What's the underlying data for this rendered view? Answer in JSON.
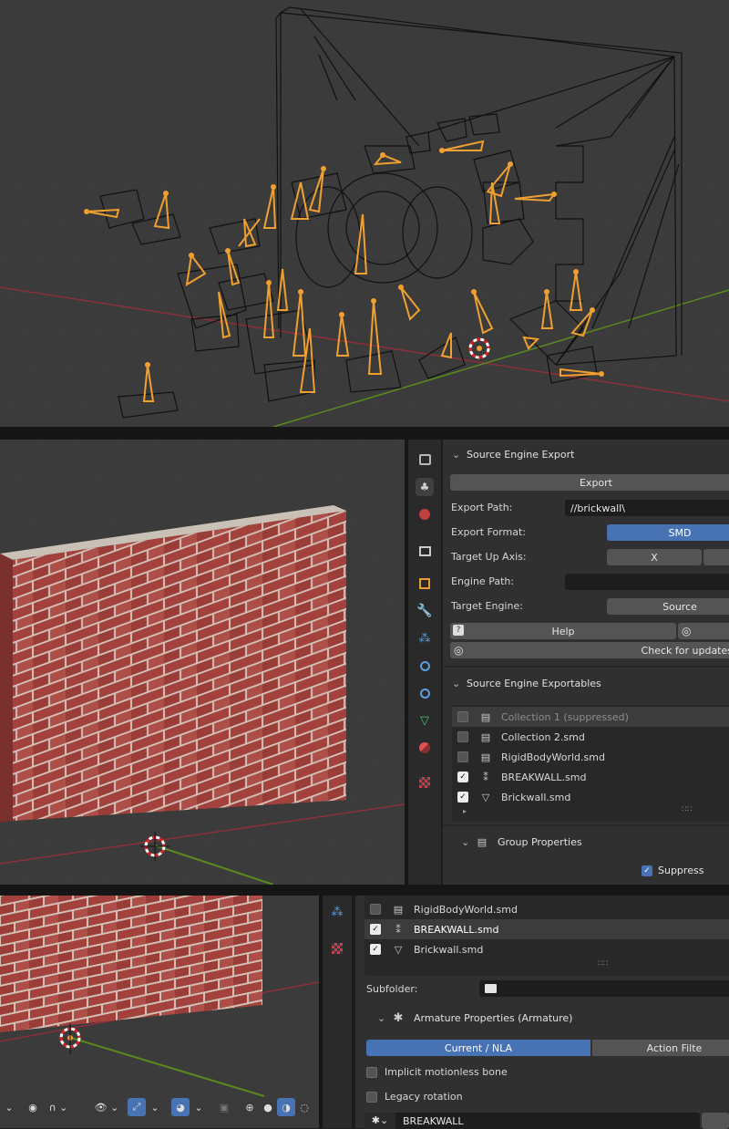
{
  "panel": {
    "export_header": "Source Engine Export",
    "export_button": "Export",
    "export_path_label": "Export Path:",
    "export_path_value": "//brickwall\\",
    "export_format_label": "Export Format:",
    "export_format_value": "SMD",
    "target_up_axis_label": "Target Up Axis:",
    "target_up_axis_value": "X",
    "engine_path_label": "Engine Path:",
    "engine_path_value": "",
    "target_engine_label": "Target Engine:",
    "target_engine_value": "Source",
    "help_label": "Help",
    "check_updates_label": "Check for updates",
    "exportables_header": "Source Engine Exportables",
    "exportables": [
      {
        "name": "Collection 1 (suppressed)",
        "checked": false,
        "icon": "collection-icon"
      },
      {
        "name": "Collection 2.smd",
        "checked": false,
        "icon": "collection-icon"
      },
      {
        "name": "RigidBodyWorld.smd",
        "checked": false,
        "icon": "collection-icon"
      },
      {
        "name": "BREAKWALL.smd",
        "checked": true,
        "icon": "armature-icon"
      },
      {
        "name": "Brickwall.smd",
        "checked": true,
        "icon": "mesh-icon"
      }
    ],
    "group_properties_header": "Group Properties",
    "suppress_label": "Suppress"
  },
  "panel2": {
    "rows": [
      {
        "name": "RigidBodyWorld.smd",
        "checked": false
      },
      {
        "name": "BREAKWALL.smd",
        "checked": true
      },
      {
        "name": "Brickwall.smd",
        "checked": true
      }
    ],
    "subfolder_label": "Subfolder:",
    "armature_header": "Armature Properties (Armature)",
    "current_nla": "Current / NLA",
    "action_filter": "Action Filte",
    "implicit_label": "Implicit motionless bone",
    "legacy_label": "Legacy rotation",
    "armature_field": "BREAKWALL"
  },
  "colors": {
    "accent": "#4772b3",
    "bone": "#f0a030",
    "grid_x": "#8c2f3a",
    "grid_y": "#5a8a1e",
    "brick": "#a4423c"
  }
}
